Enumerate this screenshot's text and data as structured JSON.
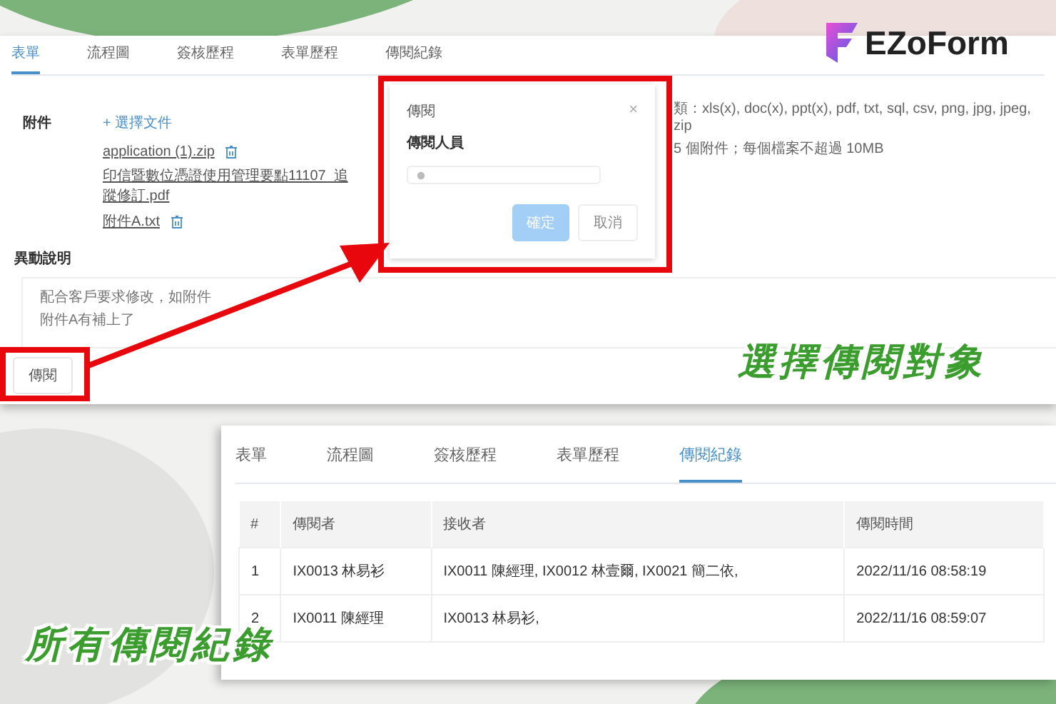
{
  "logo": {
    "text": "EZoForm"
  },
  "top_panel": {
    "tabs": [
      {
        "label": "表單",
        "selected": true
      },
      {
        "label": "流程圖",
        "selected": false
      },
      {
        "label": "簽核歷程",
        "selected": false
      },
      {
        "label": "表單歷程",
        "selected": false
      },
      {
        "label": "傳閱紀錄",
        "selected": false
      }
    ],
    "attachments": {
      "label": "附件",
      "add_link": "+ 選擇文件",
      "files": [
        "application (1).zip",
        "印信暨數位憑證使用管理要點11107_追蹤修訂.pdf",
        "附件A.txt"
      ],
      "hint_lines": [
        "類：xls(x), doc(x), ppt(x), pdf, txt, sql, csv, png, jpg, jpeg, zip",
        "5 個附件；每個檔案不超過 10MB"
      ]
    },
    "change_note": {
      "label": "異動說明",
      "lines": [
        "配合客戶要求修改，如附件",
        "附件A有補上了"
      ]
    },
    "circulate_button": "傳閱"
  },
  "dialog": {
    "title": "傳閱",
    "close": "×",
    "field_label": "傳閱人員",
    "ok_button": {
      "label": "確定",
      "disabled": true
    },
    "cancel_button": "取消"
  },
  "caption_top": "選擇傳閱對象",
  "bottom_panel": {
    "tabs": [
      {
        "label": "表單",
        "selected": false
      },
      {
        "label": "流程圖",
        "selected": false
      },
      {
        "label": "簽核歷程",
        "selected": false
      },
      {
        "label": "表單歷程",
        "selected": false
      },
      {
        "label": "傳閱紀錄",
        "selected": true
      }
    ],
    "table": {
      "columns": [
        "#",
        "傳閱者",
        "接收者",
        "傳閱時間"
      ],
      "rows": [
        [
          "1",
          "IX0013 林易衫",
          "IX0011 陳經理, IX0012 林壹爾, IX0021 簡二依,",
          "2022/11/16 08:58:19"
        ],
        [
          "2",
          "IX0011 陳經理",
          "IX0013 林易衫,",
          "2022/11/16 08:59:07"
        ]
      ]
    }
  },
  "caption_bottom": "所有傳閱紀錄"
}
